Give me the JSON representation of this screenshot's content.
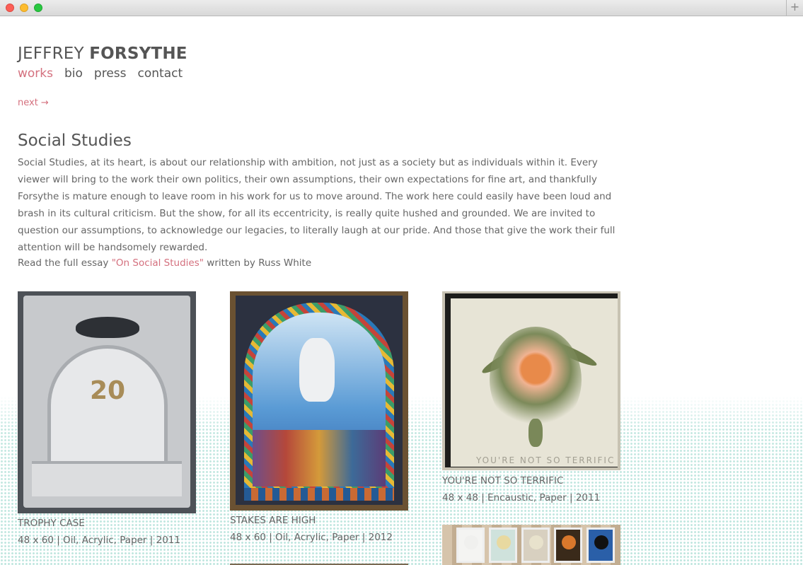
{
  "site": {
    "brand_first": "JEFFREY",
    "brand_last": "FORSYTHE"
  },
  "nav": {
    "items": [
      "works",
      "bio",
      "press",
      "contact"
    ],
    "active": "works"
  },
  "pager": {
    "next_label": "next →"
  },
  "series": {
    "title": "Social Studies",
    "description": "Social Studies, at its heart, is about our relationship with ambition, not just as a society but as individuals within it. Every viewer will bring to the work their own politics, their own assumptions, their own expectations for fine art, and thankfully Forsythe is mature enough to leave room in his work for us to move around. The work here could easily have been loud and brash in its cultural criticism. But the show, for all its eccentricity, is really quite hushed and grounded. We are invited to question our assumptions, to acknowledge our legacies, to literally laugh at our pride. And those that give the work their full attention will be handsomely rewarded.",
    "read_prefix": "Read the full essay ",
    "essay_link": "\"On Social Studies\"",
    "read_suffix": " written by Russ White"
  },
  "works": [
    {
      "title": "TROPHY CASE",
      "specs": "48 x 60 | Oil, Acrylic, Paper | 2011",
      "image_text": "20"
    },
    {
      "title": "STAKES ARE HIGH",
      "specs": "48 x 60 | Oil, Acrylic, Paper | 2012"
    },
    {
      "title": "YOU'RE NOT SO TERRIFIC",
      "specs": "48 x 48 | Encaustic, Paper | 2011",
      "image_text": "YOU'RE NOT SO TERRIFIC"
    }
  ],
  "colors": {
    "accent": "#d4707e",
    "text": "#555555",
    "halftone": "#bfe6df"
  }
}
